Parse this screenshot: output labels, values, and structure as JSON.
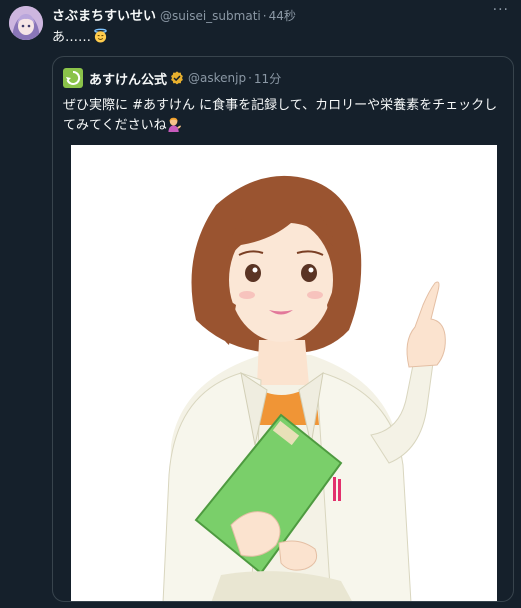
{
  "tweet": {
    "display_name": "さぶまちすいせい",
    "handle": "@suisei_submati",
    "separator": "·",
    "time": "44秒",
    "text": "あ……",
    "more_label": "···",
    "emoji": "smiling-face-with-halo"
  },
  "quote": {
    "display_name": "あすけん公式",
    "handle": "@askenjp",
    "separator": "·",
    "time": "11分",
    "text": "ぜひ実際に #あすけん に食事を記録して、カロリーや栄養素をチェックしてみてくださいね",
    "emoji": "person-tipping-hand",
    "verified_badge_color": "#e8b02e",
    "avatar_color": "#8bc34a"
  },
  "colors": {
    "background": "#15202b",
    "border": "#38444d",
    "secondary_text": "#8b98a5",
    "primary_text": "#f7f9f9"
  }
}
